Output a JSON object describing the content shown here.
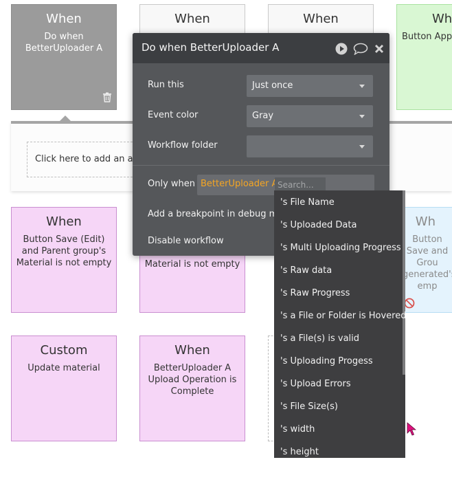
{
  "cards": {
    "c1": {
      "head": "When",
      "body": "Do when BetterUploader A"
    },
    "c2": {
      "head": "When"
    },
    "c3": {
      "head": "When"
    },
    "c4": {
      "head": "Wh",
      "body": "Button Appl"
    },
    "c5": {
      "head": "When",
      "body": "Button Save (Edit) and Parent group's Material is not empty"
    },
    "c6": {
      "body": "Material is not empty"
    },
    "c7": {
      "head": "Wh",
      "body": "Button Save and Grou generated's emp"
    },
    "c8": {
      "head": "Custom",
      "body": "Update material"
    },
    "c9": {
      "head": "When",
      "body": "BetterUploader A Upload Operation is Complete"
    }
  },
  "strip": {
    "add_action": "Click here to add an action..."
  },
  "dialog": {
    "title": "Do when BetterUploader A",
    "run_this": {
      "label": "Run this",
      "value": "Just once"
    },
    "event_color": {
      "label": "Event color",
      "value": "Gray"
    },
    "workflow_folder": {
      "label": "Workflow folder",
      "value": ""
    },
    "only_when": {
      "label": "Only when",
      "token": "BetterUploader A",
      "search_placeholder": "Search..."
    },
    "breakpoint": {
      "label": "Add a breakpoint in debug mode"
    },
    "disable": {
      "label": "Disable workflow"
    }
  },
  "dropdown": {
    "items": [
      "'s File Name",
      "'s Uploaded Data",
      "'s Multi Uploading Progress",
      "'s Raw data",
      "'s Raw Progress",
      "'s a File or Folder is Hovered",
      "'s a File(s) is valid",
      "'s Uploading Progess",
      "'s Upload Errors",
      "'s File Size(s)",
      "'s width",
      "'s height"
    ]
  },
  "icons": {
    "trash": "trash-icon",
    "play": "play-icon",
    "comment": "comment-icon",
    "close": "close-icon",
    "disabled": "no-entry-icon",
    "cursor": "mouse-pointer-icon"
  },
  "colors": {
    "accent_orange": "#f5a623",
    "cursor_magenta": "#e0117f",
    "dialog_bg": "#55575a"
  }
}
